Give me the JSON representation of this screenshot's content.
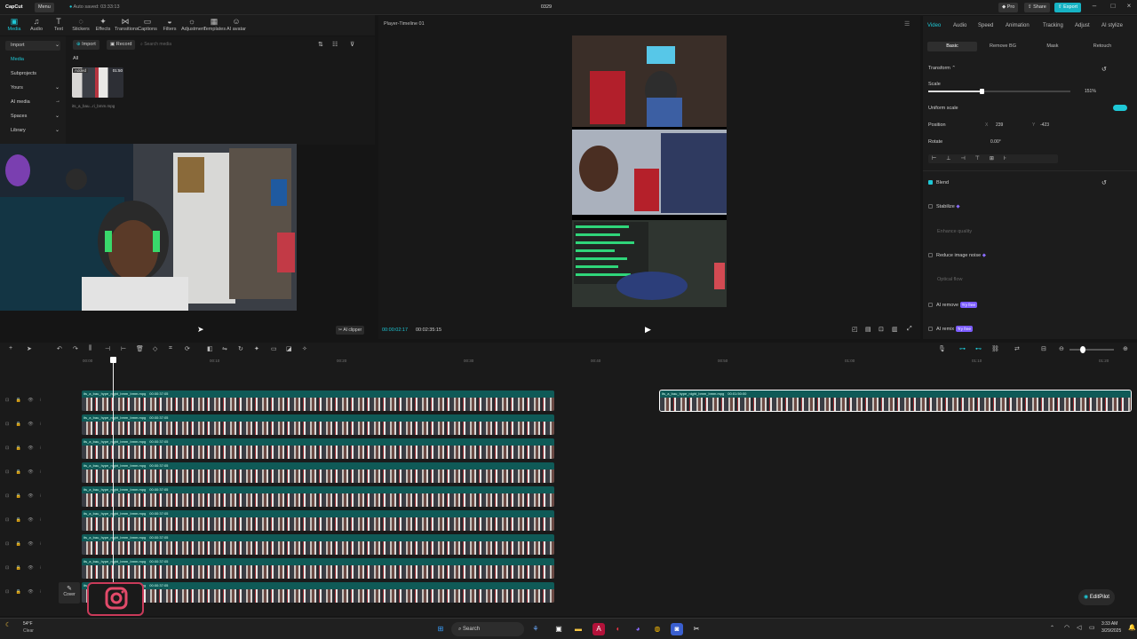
{
  "titlebar": {
    "logo": "CapCut",
    "menu_label": "Menu",
    "autosave": "Auto saved: 03:33:13",
    "project_name": "0329",
    "pro_label": "Pro",
    "share_label": "Share",
    "export_label": "Export"
  },
  "toolbar": {
    "items": [
      {
        "label": "Media",
        "icon": "media-icon"
      },
      {
        "label": "Audio",
        "icon": "audio-icon"
      },
      {
        "label": "Text",
        "icon": "text-icon"
      },
      {
        "label": "Stickers",
        "icon": "stickers-icon"
      },
      {
        "label": "Effects",
        "icon": "effects-icon"
      },
      {
        "label": "Transitions",
        "icon": "transitions-icon"
      },
      {
        "label": "Captions",
        "icon": "captions-icon"
      },
      {
        "label": "Filters",
        "icon": "filters-icon"
      },
      {
        "label": "Adjustment",
        "icon": "adjustment-icon"
      },
      {
        "label": "Templates",
        "icon": "templates-icon"
      },
      {
        "label": "AI avatar",
        "icon": "ai-avatar-icon"
      }
    ]
  },
  "leftnav": {
    "items": [
      "Import",
      "Media",
      "Subprojects",
      "Yours",
      "AI media",
      "Spaces",
      "Library"
    ]
  },
  "media": {
    "import_label": "Import",
    "record_label": "Record",
    "search_placeholder": "Search media",
    "filter_all": "All",
    "thumb_badge": "Added",
    "thumb_duration": "01:50",
    "thumb_name": "its_a_bau...ri_bmm.mpg",
    "ai_clipper": "AI clipper"
  },
  "preview": {
    "title": "Player-Timeline 01",
    "current_time": "00:00:02:17",
    "total_time": "00:02:35:15"
  },
  "right": {
    "tabs": [
      "Video",
      "Audio",
      "Speed",
      "Animation",
      "Tracking",
      "Adjust",
      "AI stylize"
    ],
    "subtabs": [
      "Basic",
      "Remove BG",
      "Mask",
      "Retouch"
    ],
    "transform_label": "Transform",
    "scale_label": "Scale",
    "scale_value": "151%",
    "uniform_scale_label": "Uniform scale",
    "position_label": "Position",
    "pos_x_label": "X",
    "pos_x": "239",
    "pos_y_label": "Y",
    "pos_y": "-423",
    "rotate_label": "Rotate",
    "rotate_value": "0.00°",
    "blend_label": "Blend",
    "stabilize_label": "Stabilize",
    "enhance_quality_label": "Enhance quality",
    "reduce_noise_label": "Reduce image noise",
    "optical_flow_label": "Optical flow",
    "ai_remove_label": "AI remove",
    "ai_remix_label": "AI remix",
    "try_free": "Try free"
  },
  "timeline": {
    "ruler": [
      "00:00",
      "00:10",
      "00:20",
      "00:30",
      "00:40",
      "00:50",
      "01:00",
      "01:10",
      "01:20"
    ],
    "clip_label": "its_a_bau_hype_night_bmm_bmm.mpg",
    "clip_duration": "00:00:37:05",
    "right_clip_label": "its_a_bau_hype_night_bmm_bmm.mpg",
    "right_clip_duration": "00:01:50:00",
    "cover_label": "Cover",
    "editpilot_label": "EditPilot"
  },
  "taskbar": {
    "weather_temp": "54°F",
    "weather_desc": "Clear",
    "search_label": "Search",
    "time": "3:33 AM",
    "date": "3/29/2025"
  },
  "colors": {
    "accent": "#1ec8d6",
    "clip": "#0f5a57",
    "purple": "#7b5cff"
  }
}
